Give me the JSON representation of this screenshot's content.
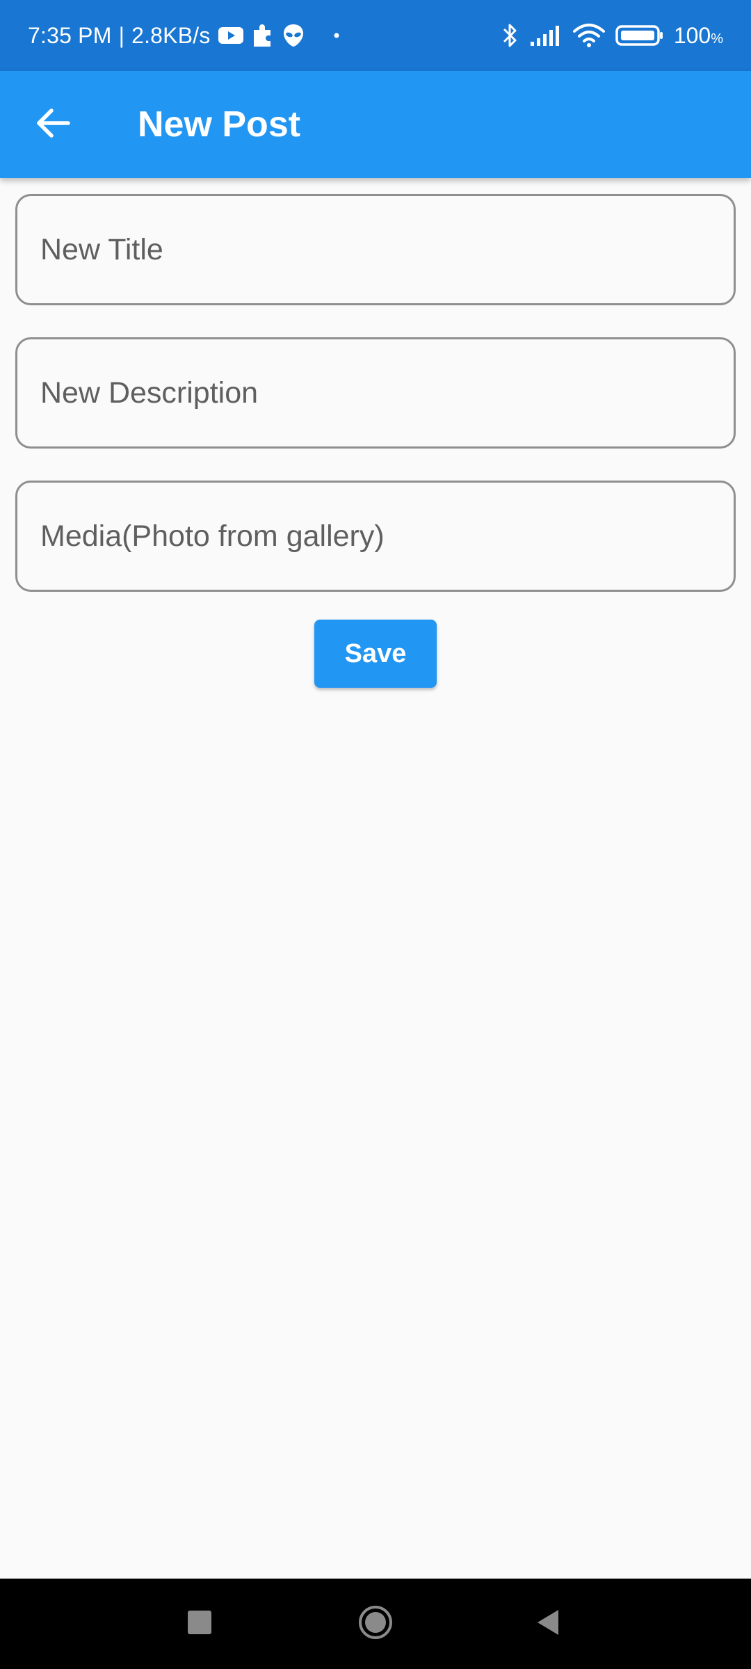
{
  "status_bar": {
    "time": "7:35 PM",
    "separator": "|",
    "speed": "2.8KB/s",
    "battery_value": "100",
    "battery_unit": "%",
    "icons_left": [
      "youtube-icon",
      "puzzle-icon",
      "alien-icon",
      "dot-icon"
    ],
    "icons_right": [
      "bluetooth-icon",
      "signal-icon",
      "wifi-icon",
      "battery-icon"
    ]
  },
  "app_bar": {
    "title": "New Post",
    "back_icon": "arrow-back-icon",
    "color": "#2196f3"
  },
  "form": {
    "title_field": {
      "placeholder": "New Title",
      "value": ""
    },
    "description_field": {
      "placeholder": "New Description",
      "value": ""
    },
    "media_field": {
      "placeholder": "Media(Photo from gallery)",
      "value": ""
    },
    "save_label": "Save"
  },
  "nav_bar": {
    "buttons": [
      "recents-icon",
      "home-icon",
      "back-icon"
    ]
  },
  "colors": {
    "status_bar": "#1976d2",
    "accent": "#2196f3",
    "background": "#fafafa",
    "field_border": "#8f8f8f"
  }
}
